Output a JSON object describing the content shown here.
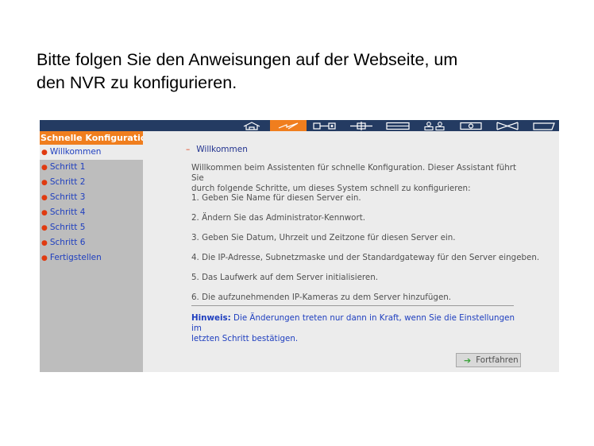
{
  "slide": {
    "heading_line1": "Bitte folgen Sie den Anweisungen auf der Webseite, um",
    "heading_line2": "den NVR zu konfigurieren."
  },
  "topnav": {
    "icons": [
      "home-icon",
      "quick-config-icon",
      "system-settings-icon",
      "network-icon",
      "storage-icon",
      "user-management-icon",
      "camera-icon",
      "close-icon",
      "log-icon"
    ],
    "active_icon": "quick-config-icon"
  },
  "sidebar": {
    "header": "Schnelle Konfiguration",
    "items": [
      {
        "label": "Willkommen",
        "active": true
      },
      {
        "label": "Schritt 1"
      },
      {
        "label": "Schritt 2"
      },
      {
        "label": "Schritt 3"
      },
      {
        "label": "Schritt 4"
      },
      {
        "label": "Schritt 5"
      },
      {
        "label": "Schritt 6"
      },
      {
        "label": "Fertigstellen"
      }
    ]
  },
  "main": {
    "breadcrumb": "Willkommen",
    "intro_line1": "Willkommen beim Assistenten für schnelle Konfiguration. Dieser Assistant führt Sie",
    "intro_line2": "durch folgende Schritte, um dieses System schnell zu konfigurieren:",
    "steps": [
      "1. Geben Sie Name für diesen Server ein.",
      "2. Ändern Sie das Administrator-Kennwort.",
      "3. Geben Sie Datum, Uhrzeit und Zeitzone für diesen Server ein.",
      "4. Die IP-Adresse, Subnetzmaske und der Standardgateway für den Server eingeben.",
      "5. Das Laufwerk auf dem Server initialisieren.",
      "6. Die aufzunehmenden IP-Kameras zu dem Server hinzufügen."
    ],
    "hint_label": "Hinweis:",
    "hint_text_line1": " Die Änderungen treten nur dann in Kraft, wenn Sie die Einstellungen im",
    "hint_text_line2": "letzten Schritt bestätigen.",
    "continue_label": "Fortfahren"
  },
  "colors": {
    "accent": "#f07e1e",
    "topbar": "#243b62",
    "link": "#1f3fbf",
    "bullet": "#e03a10"
  }
}
